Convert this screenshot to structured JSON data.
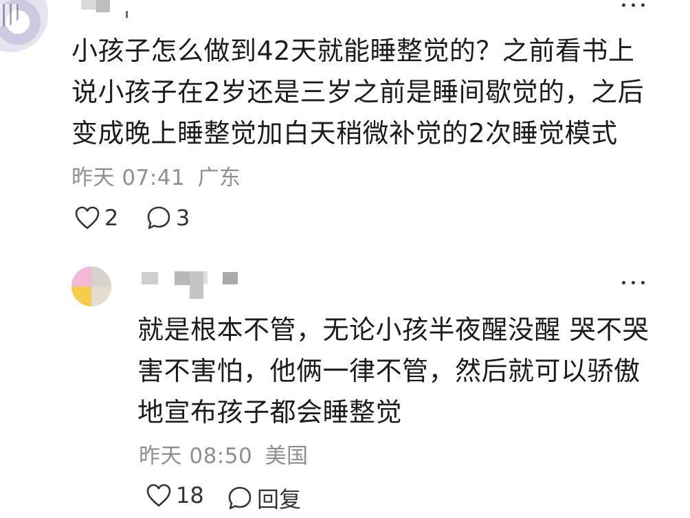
{
  "top_comment": {
    "text_lines": [
      "小孩子怎么做到42天就能睡整觉的？之前看书上",
      "说小孩子在2岁还是三岁之前是睡间歇觉的，之后",
      "变成晚上睡整觉加白天稍微补觉的2次睡觉模式"
    ],
    "time": "昨天 07:41",
    "location": "广东",
    "likes": "2",
    "replies": "3",
    "more_icon": "more-horizontal-icon"
  },
  "reply_comment": {
    "text_lines": [
      "就是根本不管，无论小孩半夜醒没醒 哭不哭",
      "害不害怕，他俩一律不管，然后就可以骄傲",
      "地宣布孩子都会睡整觉"
    ],
    "time": "昨天 08:50",
    "location": "美国",
    "likes": "18",
    "reply_label": "回复",
    "more_icon": "more-horizontal-icon"
  },
  "colors": {
    "text": "#1c1c1c",
    "meta": "#8f8f8f",
    "icon": "#333333"
  }
}
